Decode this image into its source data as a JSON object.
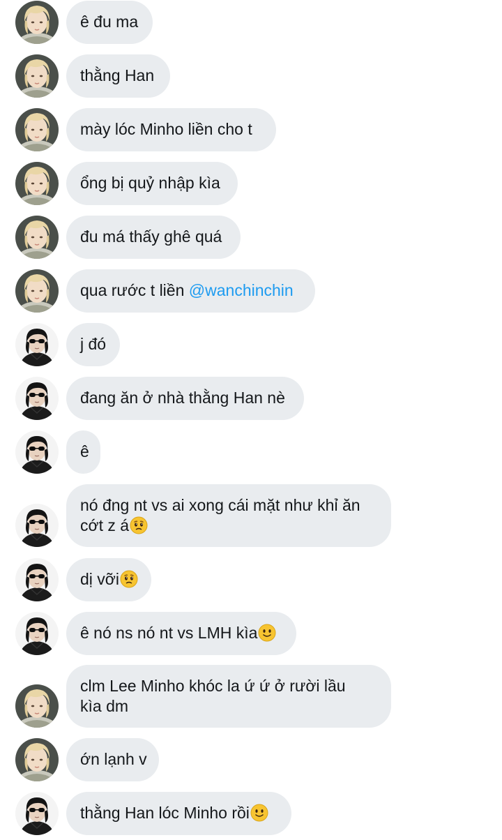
{
  "messages": [
    {
      "sender": "blonde",
      "text": "ê đu ma"
    },
    {
      "sender": "blonde",
      "text": "thằng Han"
    },
    {
      "sender": "blonde",
      "text": "mày lóc Minho liền cho t"
    },
    {
      "sender": "blonde",
      "text": "ổng bị quỷ nhập kìa"
    },
    {
      "sender": "blonde",
      "text": "đu má thấy ghê quá"
    },
    {
      "sender": "blonde",
      "text": "qua rước t liền ",
      "mention": "@wanchinchin"
    },
    {
      "sender": "dark",
      "text": "j đó"
    },
    {
      "sender": "dark",
      "text": "đang ăn ở nhà thằng Han nè"
    },
    {
      "sender": "dark",
      "text": "ê"
    },
    {
      "sender": "dark",
      "line1": "nó đng nt vs ai xong cái mặt như khỉ ăn",
      "line2": "cớt z á",
      "emoji": "worried-face-emoji"
    },
    {
      "sender": "dark",
      "text": "dị vỡi",
      "emoji": "worried-face-emoji"
    },
    {
      "sender": "dark",
      "text": "ê nó ns nó nt vs LMH kìa",
      "emoji": "slightly-smiling-face-emoji"
    },
    {
      "sender": "blonde",
      "line1": "clm Lee Minho khóc la ứ ứ ở rười lầu",
      "line2": "kìa dm"
    },
    {
      "sender": "blonde",
      "text": "ớn lạnh v"
    },
    {
      "sender": "dark",
      "text": "thằng Han lóc Minho rồi",
      "emoji": "slightly-smiling-face-emoji"
    }
  ],
  "colors": {
    "bubble_bg": "#e9ecef",
    "text": "#14171a",
    "mention": "#1d9bf0",
    "emoji_yellow": "#f7c431"
  }
}
